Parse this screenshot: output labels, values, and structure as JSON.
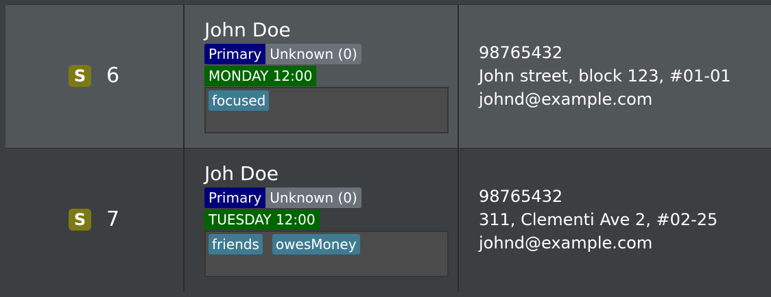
{
  "persons": [
    {
      "index_badge": "S",
      "index": "6",
      "name": "John Doe",
      "role": "Primary",
      "status": "Unknown (0)",
      "appointment": "MONDAY 12:00",
      "tags": [
        "focused"
      ],
      "phone": "98765432",
      "address": "John street, block 123, #01-01",
      "email": "johnd@example.com"
    },
    {
      "index_badge": "S",
      "index": "7",
      "name": "Joh Doe",
      "role": "Primary",
      "status": "Unknown (0)",
      "appointment": "TUESDAY 12:00",
      "tags": [
        "friends",
        "owesMoney"
      ],
      "phone": "98765432",
      "address": "311, Clementi Ave 2, #02-25",
      "email": "johnd@example.com"
    }
  ],
  "colors": {
    "selected_row": "#515658",
    "row": "#3c3f41",
    "badge_s": "#7d7a16",
    "role_primary": "#00007a",
    "status_unknown": "#6b7279",
    "appointment": "#006400",
    "tag": "#3e7b91"
  }
}
